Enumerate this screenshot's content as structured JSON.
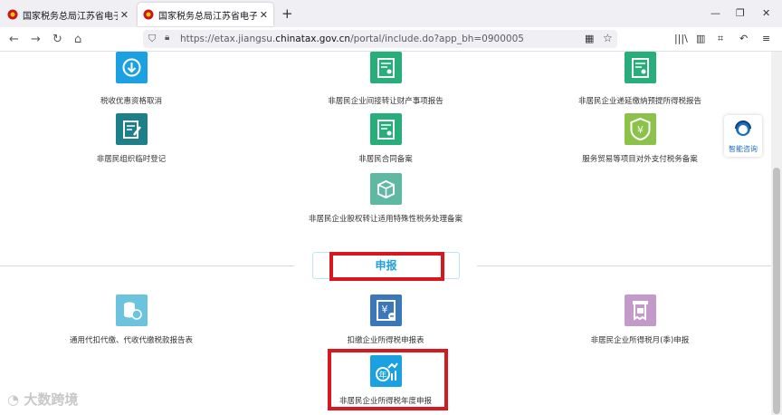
{
  "browser": {
    "tabs": [
      {
        "title": "国家税务总局江苏省电子税务局",
        "active": false
      },
      {
        "title": "国家税务总局江苏省电子税务局",
        "active": true
      }
    ],
    "url_prefix": "https://etax.jiangsu.",
    "url_domain": "chinatax.gov.cn",
    "url_suffix": "/portal/include.do?app_bh=0900005"
  },
  "services_top": [
    {
      "label": "税收优惠资格取消",
      "color": "#1ba1e2",
      "icon": "download-icon"
    },
    {
      "label": "非居民企业间接转让财产事项报告",
      "color": "#27ae7a",
      "icon": "certificate-icon"
    },
    {
      "label": "非居民企业递延缴纳预提所得税报告",
      "color": "#27ae7a",
      "icon": "certificate-icon"
    },
    {
      "label": "非居民组织临时登记",
      "color": "#1c7f8a",
      "icon": "edit-icon"
    },
    {
      "label": "非居民合同备案",
      "color": "#27ae7a",
      "icon": "certificate-icon"
    },
    {
      "label": "服务贸易等项目对外支付税务备案",
      "color": "#8bc34a",
      "icon": "yen-shield-icon"
    },
    {
      "label": "非居民企业股权转让适用特殊性税务处理备案",
      "color": "#5fb8a2",
      "icon": "box-icon"
    }
  ],
  "section": {
    "title": "申报"
  },
  "services_bottom": [
    {
      "label": "通用代扣代缴、代收代缴税款报告表",
      "color": "#6cc3de",
      "icon": "coins-icon"
    },
    {
      "label": "扣缴企业所得税申报表",
      "color": "#3b78ba",
      "icon": "yen-form-icon"
    },
    {
      "label": "非居民企业所得税月(季)申报",
      "color": "#c39ac9",
      "icon": "tax-bill-icon"
    },
    {
      "label": "非居民企业所得税年度申报",
      "color": "#1ba1e2",
      "icon": "annual-chart-icon"
    }
  ],
  "float_help": {
    "label": "智能咨询"
  },
  "watermark": "大数跨境"
}
